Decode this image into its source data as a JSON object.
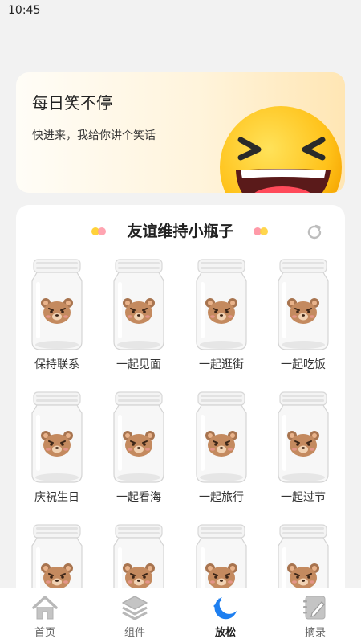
{
  "status_bar": {
    "time": "10:45"
  },
  "banner": {
    "title": "每日笑不停",
    "subtitle": "快进来，我给你讲个笑话",
    "icon": "laughing-emoji-icon"
  },
  "card": {
    "title": "友谊维持小瓶子",
    "refresh_icon": "refresh-icon",
    "jars": [
      {
        "label": "保持联系"
      },
      {
        "label": "一起见面"
      },
      {
        "label": "一起逛街"
      },
      {
        "label": "一起吃饭"
      },
      {
        "label": "庆祝生日"
      },
      {
        "label": "一起看海"
      },
      {
        "label": "一起旅行"
      },
      {
        "label": "一起过节"
      },
      {
        "label": ""
      },
      {
        "label": ""
      },
      {
        "label": ""
      },
      {
        "label": ""
      }
    ]
  },
  "tabbar": {
    "tabs": [
      {
        "label": "首页",
        "icon": "home-icon"
      },
      {
        "label": "组件",
        "icon": "layers-icon"
      },
      {
        "label": "放松",
        "icon": "moon-icon",
        "active": true
      },
      {
        "label": "摘录",
        "icon": "notebook-pen-icon"
      }
    ]
  },
  "colors": {
    "accent": "#1e7ff0",
    "banner_gradient_end": "#ffe6b4",
    "inactive_icon": "#b8b8b8"
  }
}
